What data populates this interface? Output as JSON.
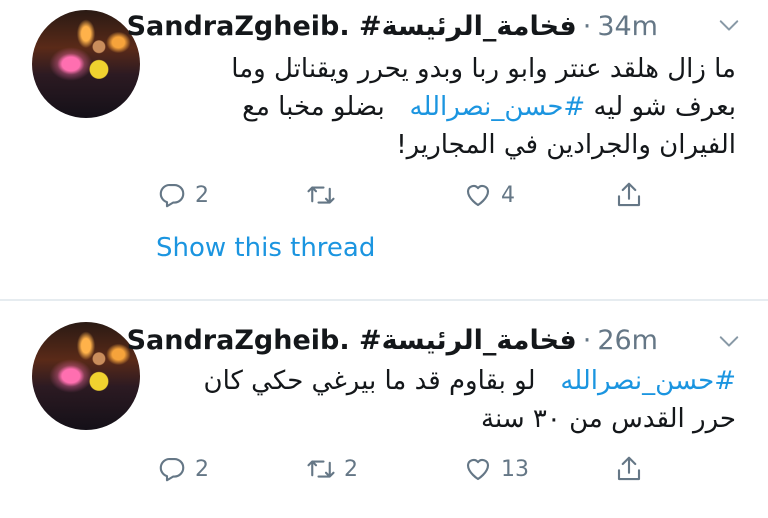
{
  "tweets": [
    {
      "author_name": "SandraZgheib. #فخامة_الرئيسة",
      "dot": "·",
      "time": "34m",
      "text_lines": [
        "ما زال هلقد عنتر وابو ربا وبدو يحرر ويقناتل وما",
        "بعرف شو ليه",
        "الفيران  والجرادين في المجارير!"
      ],
      "hashtag": "#حسن_نصرالله",
      "line2_rest": "بضلو مخبا مع",
      "reply_count": "2",
      "retweet_count": "",
      "like_count": "4",
      "show_thread": "Show this thread"
    },
    {
      "author_name": "SandraZgheib. #فخامة_الرئيسة",
      "dot": "·",
      "time": "26m",
      "hashtag": "#حسن_نصرالله",
      "line1_rest": "لو بقاوم قد ما بيرغي حكي كان",
      "line2": "حرر القدس من ٣٠ سنة",
      "reply_count": "2",
      "retweet_count": "2",
      "like_count": "13"
    }
  ],
  "icons": {
    "reply": "reply-icon",
    "retweet": "retweet-icon",
    "like": "heart-icon",
    "share": "share-icon",
    "more": "chevron-down-icon"
  },
  "colors": {
    "link": "#1b95e0",
    "muted": "#657786",
    "text": "#14171a",
    "divider": "#e6ecf0"
  }
}
